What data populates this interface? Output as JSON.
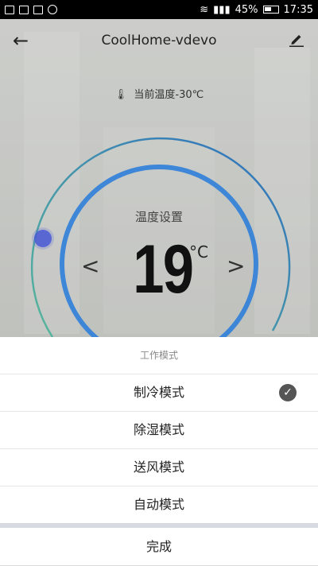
{
  "status_bar": {
    "battery": "45%",
    "time": "17:35"
  },
  "app_bar": {
    "title": "CoolHome-vdevo"
  },
  "current_temperature": {
    "label": "当前温度-30℃"
  },
  "thermostat": {
    "setting_label": "温度设置",
    "value": "19",
    "unit": "°C"
  },
  "mode_sheet": {
    "title": "工作模式",
    "options": [
      {
        "label": "制冷模式",
        "selected": true
      },
      {
        "label": "除湿模式",
        "selected": false
      },
      {
        "label": "送风模式",
        "selected": false
      },
      {
        "label": "自动模式",
        "selected": false
      }
    ],
    "done_label": "完成"
  },
  "colors": {
    "ring_outer_start": "#58b79b",
    "ring_outer_end": "#2e6fbf",
    "ring_inner": "#2f7ed8",
    "knob": "#4a5bd4"
  }
}
